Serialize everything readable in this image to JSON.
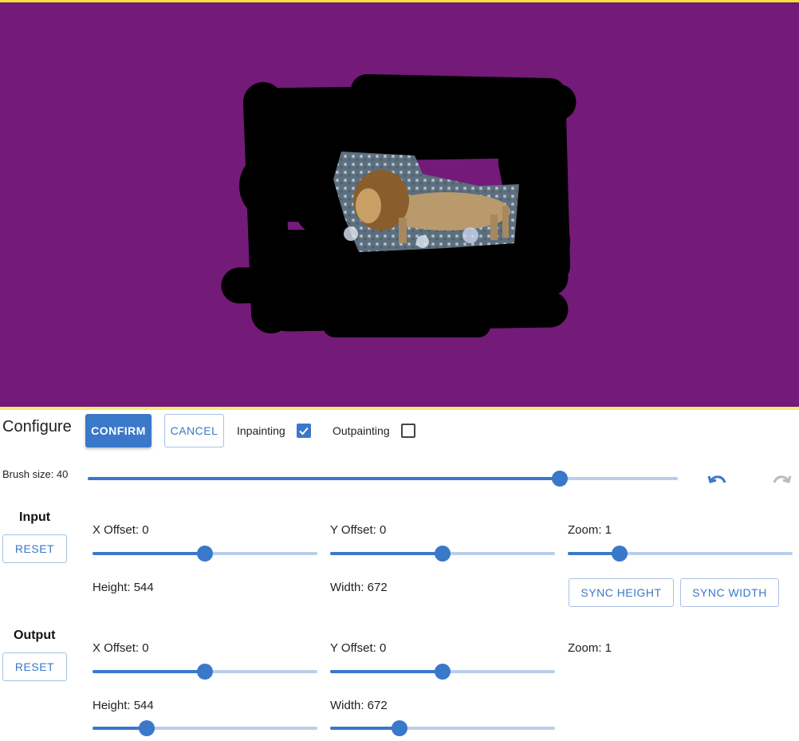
{
  "canvas": {
    "background": "#741a78",
    "image": "lion-image"
  },
  "toolbar": {
    "title": "Configure",
    "confirm_label": "CONFIRM",
    "cancel_label": "CANCEL",
    "inpainting_label": "Inpainting",
    "inpainting_checked": true,
    "outpainting_label": "Outpainting",
    "outpainting_checked": false
  },
  "brush": {
    "label": "Brush size: 40",
    "level": 0.8,
    "undo_icon": "undo-icon",
    "redo_icon": "redo-icon"
  },
  "input": {
    "title": "Input",
    "reset_label": "RESET",
    "x_offset_label": "X Offset: 0",
    "x_offset_level": 0.5,
    "y_offset_label": "Y Offset: 0",
    "y_offset_level": 0.5,
    "zoom_label": "Zoom: 1",
    "zoom_level": 0.23,
    "height_label": "Height: 544",
    "width_label": "Width: 672",
    "sync_height_label": "SYNC HEIGHT",
    "sync_width_label": "SYNC WIDTH"
  },
  "output": {
    "title": "Output",
    "reset_label": "RESET",
    "x_offset_label": "X Offset: 0",
    "x_offset_level": 0.5,
    "y_offset_label": "Y Offset: 0",
    "y_offset_level": 0.5,
    "zoom_label": "Zoom: 1",
    "height_label": "Height: 544",
    "height_level": 0.24,
    "width_label": "Width: 672",
    "width_level": 0.31
  },
  "colors": {
    "accent": "#3a78c9",
    "rail": "#b9cfe9",
    "canvas": "#741a78",
    "highlight": "#f2e43a"
  }
}
